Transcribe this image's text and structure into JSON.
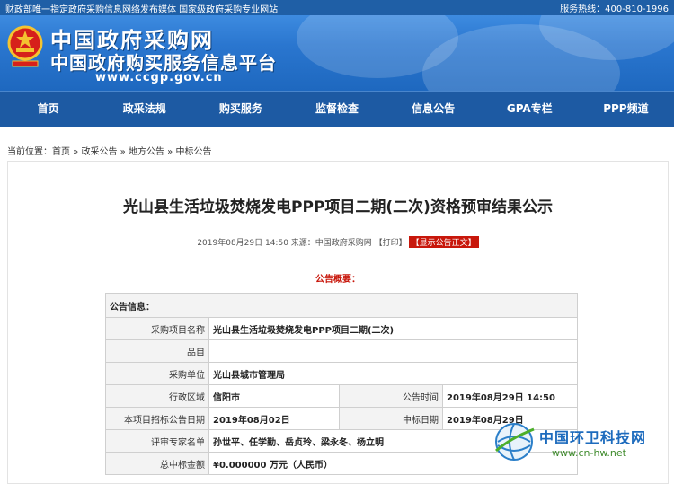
{
  "topbar": {
    "left": "财政部唯一指定政府采购信息网络发布媒体 国家级政府采购专业网站",
    "hotline_label": "服务热线：",
    "hotline_number": "400-810-1996"
  },
  "header": {
    "title": "中国政府采购网",
    "subtitle": "中国政府购买服务信息平台",
    "url": "www.ccgp.gov.cn"
  },
  "nav": [
    "首页",
    "政采法规",
    "购买服务",
    "监督检查",
    "信息公告",
    "GPA专栏",
    "PPP频道"
  ],
  "breadcrumb": {
    "prefix": "当前位置：",
    "items": [
      "首页",
      "政采公告",
      "地方公告",
      "中标公告"
    ],
    "sep": " » "
  },
  "article": {
    "title": "光山县生活垃圾焚烧发电PPP项目二期(二次)资格预审结果公示",
    "meta": "2019年08月29日 14:50 来源：中国政府采购网 【打印】",
    "show_button": "【显示公告正文】",
    "summary_label": "公告概要："
  },
  "info_table": {
    "header": "公告信息：",
    "rows": {
      "project_name": {
        "label": "采购项目名称",
        "value": "光山县生活垃圾焚烧发电PPP项目二期(二次)"
      },
      "item": {
        "label": "品目",
        "value": ""
      },
      "unit": {
        "label": "采购单位",
        "value": "光山县城市管理局"
      },
      "region": {
        "label": "行政区域",
        "value": "信阳市"
      },
      "pub_time": {
        "label": "公告时间",
        "value": "2019年08月29日 14:50"
      },
      "bid_date": {
        "label": "本项目招标公告日期",
        "value": "2019年08月02日"
      },
      "win_date": {
        "label": "中标日期",
        "value": "2019年08月29日"
      },
      "experts": {
        "label": "评审专家名单",
        "value": "孙世平、任学勤、岳贞玲、梁永冬、杨立明"
      },
      "amount": {
        "label": "总中标金额",
        "value": "¥0.000000 万元（人民币）"
      }
    }
  },
  "watermark": {
    "cn": "中国环卫科技网",
    "en": "www.cn-hw.net"
  },
  "colors": {
    "brand_blue": "#1d5aa3",
    "accent_red": "#c8170b"
  }
}
